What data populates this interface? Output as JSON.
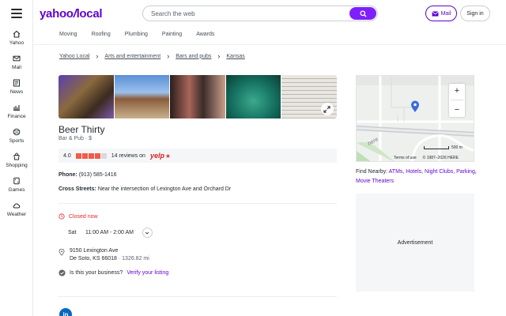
{
  "header": {
    "logo_main": "yahoo",
    "logo_slash": "/",
    "logo_sub": "local",
    "search_placeholder": "Search the web",
    "mail_label": "Mail",
    "signin_label": "Sign in"
  },
  "rail": {
    "items": [
      {
        "label": "Yahoo",
        "icon": "home-icon"
      },
      {
        "label": "Mail",
        "icon": "mail-icon"
      },
      {
        "label": "News",
        "icon": "news-icon"
      },
      {
        "label": "Finance",
        "icon": "finance-icon"
      },
      {
        "label": "Sports",
        "icon": "sports-icon"
      },
      {
        "label": "Shopping",
        "icon": "shopping-icon"
      },
      {
        "label": "Games",
        "icon": "games-icon"
      },
      {
        "label": "Weather",
        "icon": "weather-icon"
      }
    ]
  },
  "categories": [
    "Moving",
    "Roofing",
    "Plumbing",
    "Painting",
    "Awards"
  ],
  "breadcrumb": [
    "Yahoo Local",
    "Arts and entertainment",
    "Bars and pubs",
    "Kansas"
  ],
  "business": {
    "name": "Beer Thirty",
    "category": "Bar & Pub · $",
    "rating": "4.0",
    "rating_value": 4.0,
    "reviews": "14 reviews on",
    "review_source": "yelp",
    "phone_label": "Phone:",
    "phone": "(913) 585-1416",
    "cross_label": "Cross Streets:",
    "cross_streets": "Near the intersection of Lexington Ave and Orchard Dr",
    "status": "Closed now",
    "hours_day": "Sat",
    "hours_time": "11:00 AM - 2:00 AM",
    "address_line1": "9150 Lexington Ave",
    "address_line2": "De Soto, KS 66018",
    "distance": "· 1326.82 mi",
    "claim_text": "Is this your business?",
    "claim_link": "Verify your listing",
    "social": "in"
  },
  "map": {
    "zoom_in": "+",
    "zoom_out": "−",
    "scale": "500 m",
    "terms": "Terms of use",
    "copyright": "© 1987–2026 HERE",
    "watermark": "here"
  },
  "nearby": {
    "label": "Find Nearby:",
    "links": [
      "ATMs",
      "Hotels",
      "Night Clubs",
      "Parking",
      "Movie Theaters"
    ]
  },
  "ad_label": "Advertisement",
  "colors": {
    "brand": "#5f01d1",
    "search_button": "#7e1fff",
    "closed": "#e0292b",
    "yelp": "#d32323",
    "star": "#f15c4a"
  }
}
